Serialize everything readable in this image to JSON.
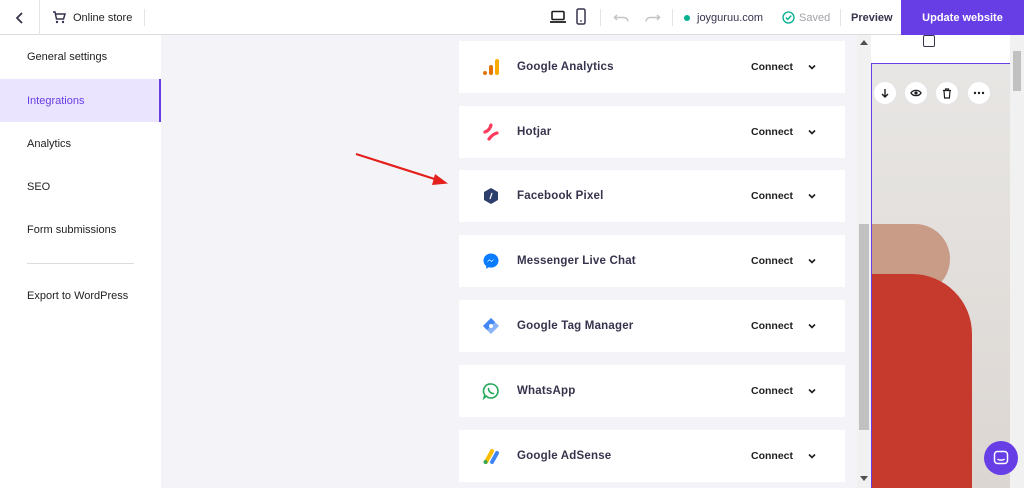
{
  "topbar": {
    "store_label": "Online store",
    "domain": "joyguruu.com",
    "saved_label": "Saved",
    "preview_label": "Preview",
    "update_label": "Update website"
  },
  "sidebar": {
    "items": [
      {
        "label": "General settings"
      },
      {
        "label": "Integrations"
      },
      {
        "label": "Analytics"
      },
      {
        "label": "SEO"
      },
      {
        "label": "Form submissions"
      },
      {
        "label": "Export to WordPress"
      }
    ]
  },
  "integrations": [
    {
      "name": "Google Analytics",
      "action": "Connect",
      "icon": "google-analytics-icon"
    },
    {
      "name": "Hotjar",
      "action": "Connect",
      "icon": "hotjar-icon"
    },
    {
      "name": "Facebook Pixel",
      "action": "Connect",
      "icon": "facebook-pixel-icon"
    },
    {
      "name": "Messenger Live Chat",
      "action": "Connect",
      "icon": "messenger-icon"
    },
    {
      "name": "Google Tag Manager",
      "action": "Connect",
      "icon": "google-tag-manager-icon"
    },
    {
      "name": "WhatsApp",
      "action": "Connect",
      "icon": "whatsapp-icon"
    },
    {
      "name": "Google AdSense",
      "action": "Connect",
      "icon": "google-adsense-icon"
    }
  ],
  "colors": {
    "accent": "#673de6",
    "active_bg": "#ebe4ff",
    "annotation": "#e3201b"
  }
}
